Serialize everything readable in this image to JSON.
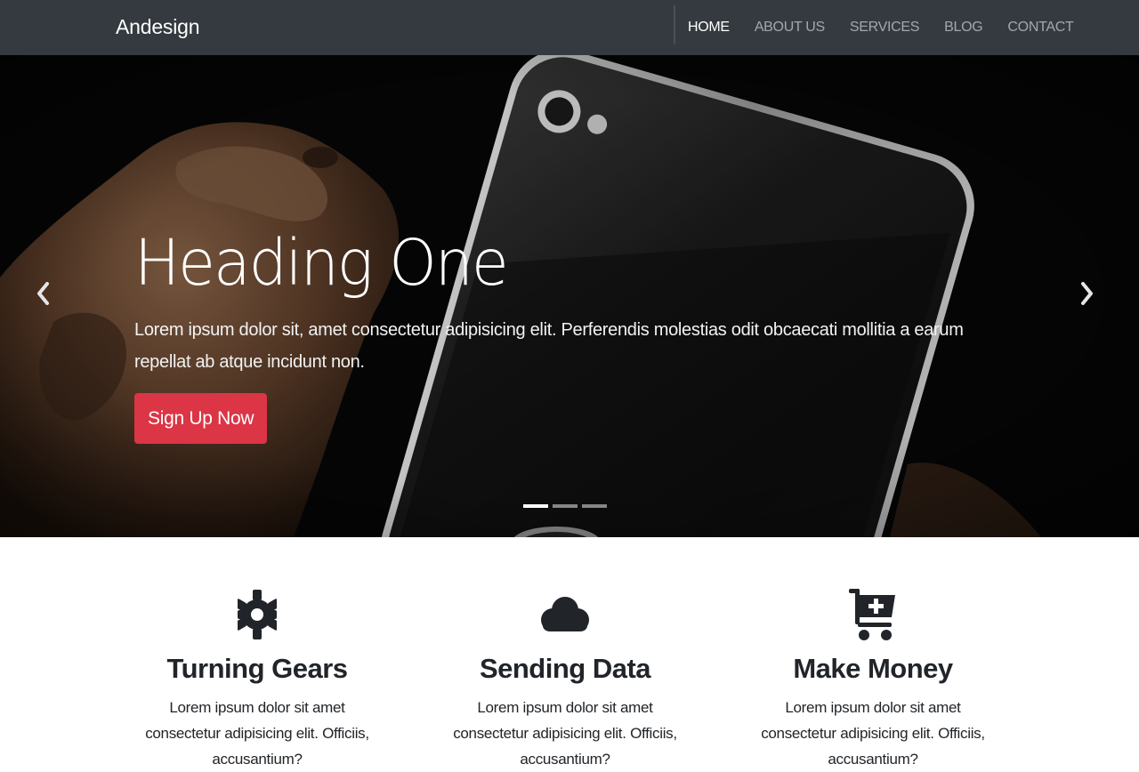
{
  "navbar": {
    "brand": "Andesign",
    "links": [
      {
        "label": "HOME",
        "active": true
      },
      {
        "label": "ABOUT US",
        "active": false
      },
      {
        "label": "SERVICES",
        "active": false
      },
      {
        "label": "BLOG",
        "active": false
      },
      {
        "label": "CONTACT",
        "active": false
      }
    ]
  },
  "hero": {
    "title": "Heading One",
    "text": "Lorem ipsum dolor sit, amet consectetur adipisicing elit. Perferendis molestias odit obcaecati mollitia a earum repellat ab atque incidunt non.",
    "button_label": "Sign Up Now",
    "button_color": "#dc3545",
    "slides_count": 3,
    "active_slide": 1,
    "prev_icon": "chevron-left-icon",
    "next_icon": "chevron-right-icon"
  },
  "features": [
    {
      "icon": "gear-icon",
      "title": "Turning Gears",
      "text": "Lorem ipsum dolor sit amet consectetur adipisicing elit. Officiis, accusantium?"
    },
    {
      "icon": "cloud-icon",
      "title": "Sending Data",
      "text": "Lorem ipsum dolor sit amet consectetur adipisicing elit. Officiis, accusantium?"
    },
    {
      "icon": "cart-plus-icon",
      "title": "Make Money",
      "text": "Lorem ipsum dolor sit amet consectetur adipisicing elit. Officiis, accusantium?"
    }
  ],
  "colors": {
    "navbar_bg": "#343a40",
    "accent": "#dc3545",
    "icon": "#212529"
  }
}
